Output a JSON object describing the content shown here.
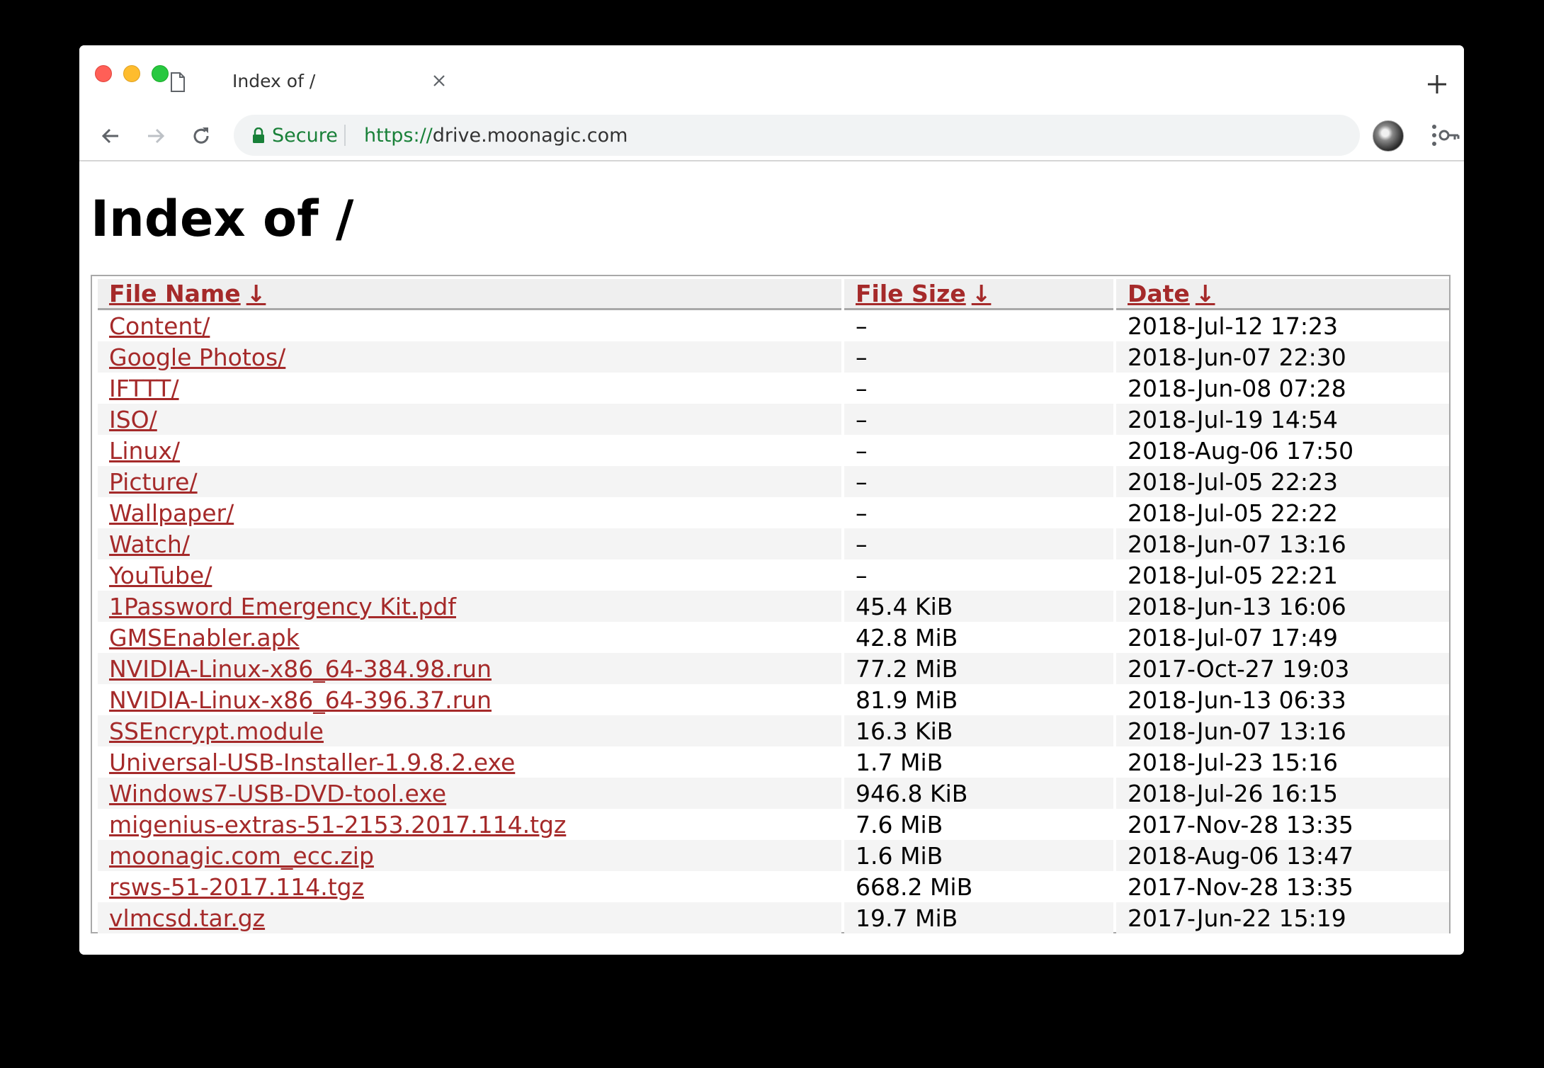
{
  "browser": {
    "tab": {
      "title": "Index of /",
      "icon": "document-icon"
    },
    "secure_label": "Secure",
    "url_protocol": "https://",
    "url_host": "drive.moonagic.com",
    "colors": {
      "secure": "#188038",
      "link": "#a52a2a"
    }
  },
  "page": {
    "title": "Index of /",
    "columns": {
      "name": "File Name",
      "size": "File Size",
      "date": "Date",
      "sort_arrow": "↓"
    },
    "rows": [
      {
        "name": "Content/",
        "size": "–",
        "date": "2018-Jul-12 17:23"
      },
      {
        "name": "Google Photos/",
        "size": "–",
        "date": "2018-Jun-07 22:30"
      },
      {
        "name": "IFTTT/",
        "size": "–",
        "date": "2018-Jun-08 07:28"
      },
      {
        "name": "ISO/",
        "size": "–",
        "date": "2018-Jul-19 14:54"
      },
      {
        "name": "Linux/",
        "size": "–",
        "date": "2018-Aug-06 17:50"
      },
      {
        "name": "Picture/",
        "size": "–",
        "date": "2018-Jul-05 22:23"
      },
      {
        "name": "Wallpaper/",
        "size": "–",
        "date": "2018-Jul-05 22:22"
      },
      {
        "name": "Watch/",
        "size": "–",
        "date": "2018-Jun-07 13:16"
      },
      {
        "name": "YouTube/",
        "size": "–",
        "date": "2018-Jul-05 22:21"
      },
      {
        "name": "1Password Emergency Kit.pdf",
        "size": "45.4 KiB",
        "date": "2018-Jun-13 16:06"
      },
      {
        "name": "GMSEnabler.apk",
        "size": "42.8 MiB",
        "date": "2018-Jul-07 17:49"
      },
      {
        "name": "NVIDIA-Linux-x86_64-384.98.run",
        "size": "77.2 MiB",
        "date": "2017-Oct-27 19:03"
      },
      {
        "name": "NVIDIA-Linux-x86_64-396.37.run",
        "size": "81.9 MiB",
        "date": "2018-Jun-13 06:33"
      },
      {
        "name": "SSEncrypt.module",
        "size": "16.3 KiB",
        "date": "2018-Jun-07 13:16"
      },
      {
        "name": "Universal-USB-Installer-1.9.8.2.exe",
        "size": "1.7 MiB",
        "date": "2018-Jul-23 15:16"
      },
      {
        "name": "Windows7-USB-DVD-tool.exe",
        "size": "946.8 KiB",
        "date": "2018-Jul-26 16:15"
      },
      {
        "name": "migenius-extras-51-2153.2017.114.tgz",
        "size": "7.6 MiB",
        "date": "2017-Nov-28 13:35"
      },
      {
        "name": "moonagic.com_ecc.zip",
        "size": "1.6 MiB",
        "date": "2018-Aug-06 13:47"
      },
      {
        "name": "rsws-51-2017.114.tgz",
        "size": "668.2 MiB",
        "date": "2017-Nov-28 13:35"
      },
      {
        "name": "vlmcsd.tar.gz",
        "size": "19.7 MiB",
        "date": "2017-Jun-22 15:19"
      }
    ]
  }
}
